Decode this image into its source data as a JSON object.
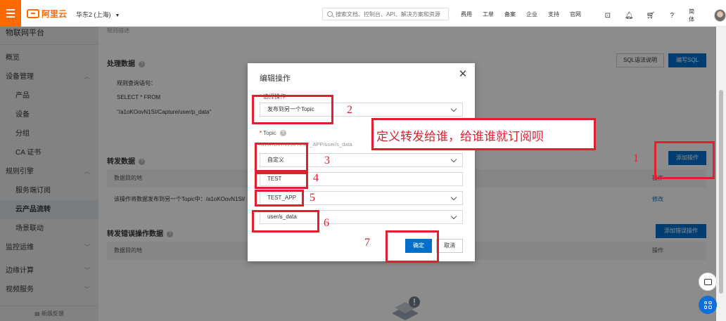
{
  "topbar": {
    "logo": "阿里云",
    "region": "华东2 (上海)",
    "search_placeholder": "搜索文档、控制台、API、解决方案和资源",
    "nav": [
      "费用",
      "工单",
      "备案",
      "企业",
      "支持",
      "官网"
    ],
    "lang": "简体"
  },
  "sidebar": {
    "title": "物联网平台",
    "items": [
      {
        "label": "概览"
      },
      {
        "label": "设备管理"
      },
      {
        "label": "产品"
      },
      {
        "label": "设备"
      },
      {
        "label": "分组"
      },
      {
        "label": "CA 证书"
      },
      {
        "label": "规则引擎"
      },
      {
        "label": "服务端订阅"
      },
      {
        "label": "云产品流转"
      },
      {
        "label": "场景联动"
      },
      {
        "label": "监控运维"
      },
      {
        "label": "边缘计算"
      },
      {
        "label": "视频服务"
      }
    ],
    "feedback": "新版反馈"
  },
  "main": {
    "rule_desc": "规则描述",
    "process_title": "处理数据",
    "sql_help": "SQL语法说明",
    "write_sql": "编写SQL",
    "query_label": "规则查询语句：",
    "select_line": "SELECT * FROM",
    "topic_line": "\"/a1oKOovN1SI/Capture/user/p_data\"",
    "forward_title": "转发数据",
    "add_action": "添加操作",
    "col_dest": "数据目的地",
    "col_action": "操作",
    "forward_desc": "该操作将数据发布到另一个Topic中：/a1oKOovN1SI/",
    "edit_link": "修改",
    "error_title": "转发错误操作数据",
    "add_error_action": "添加错误操作",
    "col_dest2": "数据目的地",
    "col_action2": "操作"
  },
  "modal": {
    "title": "编辑操作",
    "select_action_label": "选择操作",
    "select_action_value": "发布到另一个Topic",
    "topic_label": "Topic",
    "topic_hint": "/a1oKOovN1SI/TEST_APP/user/s_data",
    "custom_value": "自定义",
    "product_value": "TEST",
    "device_value": "TEST_APP",
    "topic_value": "user/s_data",
    "ok": "确定",
    "cancel": "取消"
  },
  "annotations": {
    "numbers": [
      "1",
      "2",
      "3",
      "4",
      "5",
      "6",
      "7"
    ],
    "note": "定义转发给谁，给谁谁就订阅呗"
  }
}
